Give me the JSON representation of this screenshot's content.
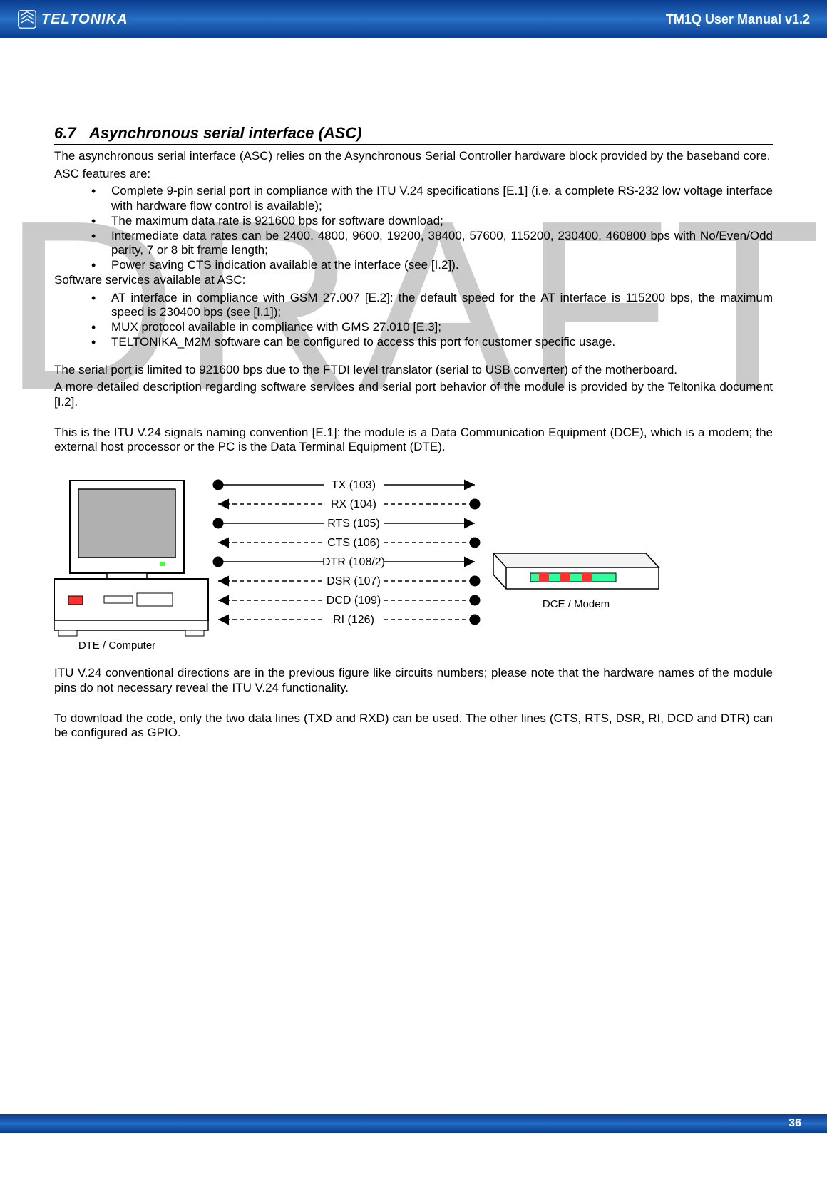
{
  "header": {
    "brand": "TELTONIKA",
    "title": "TM1Q User Manual v1.2"
  },
  "section": {
    "number": "6.7",
    "title": "Asynchronous serial interface (ASC)"
  },
  "intro": {
    "p1": "The asynchronous serial interface (ASC) relies on the Asynchronous Serial Controller hardware block provided by the baseband core.",
    "p2": "ASC features are:"
  },
  "features": [
    "Complete 9-pin serial port in compliance with the ITU V.24 specifications [E.1] (i.e. a complete RS-232 low voltage interface with hardware flow control is available);",
    "The maximum data rate is 921600 bps for software download;",
    "Intermediate data rates can be 2400, 4800, 9600, 19200, 38400, 57600, 115200, 230400, 460800 bps with No/Even/Odd parity, 7 or 8 bit frame length;",
    "Power saving CTS indication available at the interface (see [I.2])."
  ],
  "services_intro": "Software services available at ASC:",
  "services": [
    "AT interface in compliance with GSM 27.007 [E.2]: the default speed for the AT interface is 115200 bps, the maximum speed is 230400 bps (see [I.1]);",
    "MUX protocol available in compliance with GMS 27.010 [E.3];",
    "TELTONIKA_M2M software can be configured to access this port for customer specific usage."
  ],
  "midtext": {
    "p1": "The serial port is limited to 921600 bps due to the FTDI level translator (serial to USB converter) of the motherboard.",
    "p2": "A more detailed description regarding software services and serial port behavior of the module is provided by the Teltonika document [I.2].",
    "p3": "This is the ITU V.24 signals naming convention [E.1]: the module is a Data Communication Equipment (DCE), which is a modem; the external host processor or the PC is the Data Terminal Equipment (DTE)."
  },
  "diagram": {
    "dte_label": "DTE / Computer",
    "dce_label": "DCE / Modem",
    "signals": [
      {
        "name": "TX (103)",
        "dir": "right"
      },
      {
        "name": "RX (104)",
        "dir": "left"
      },
      {
        "name": "RTS (105)",
        "dir": "right"
      },
      {
        "name": "CTS (106)",
        "dir": "left"
      },
      {
        "name": "DTR (108/2)",
        "dir": "right"
      },
      {
        "name": "DSR (107)",
        "dir": "left"
      },
      {
        "name": "DCD (109)",
        "dir": "left"
      },
      {
        "name": "RI (126)",
        "dir": "left"
      }
    ]
  },
  "posttext": {
    "p1": "ITU V.24 conventional directions are in the previous figure like circuits numbers; please note that the hardware names of the module pins do not necessary reveal the ITU V.24 functionality.",
    "p2": "To download the code, only the two data lines (TXD and RXD) can be used. The other lines (CTS, RTS, DSR, RI, DCD and DTR) can be configured as GPIO."
  },
  "footer": {
    "page": "36"
  },
  "watermark": "DRAFT"
}
